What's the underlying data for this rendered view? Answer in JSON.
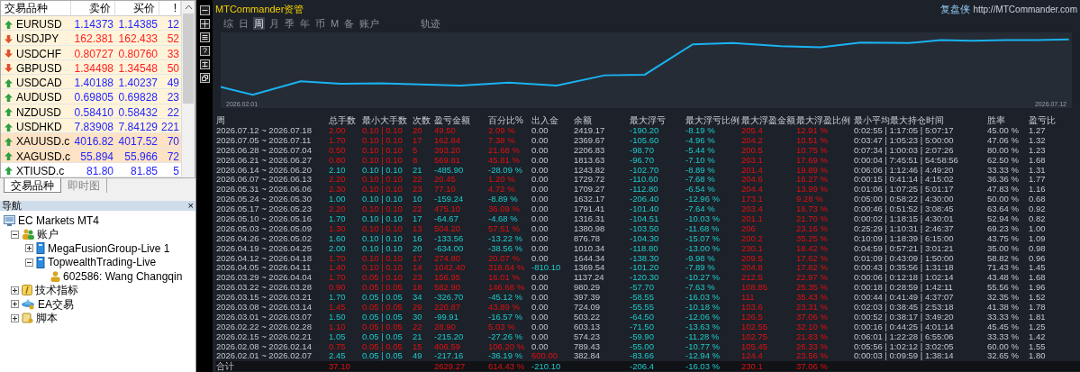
{
  "market_watch": {
    "columns": [
      "交易品种",
      "卖价",
      "买价",
      "!"
    ],
    "rows": [
      {
        "symbol": "EURUSD",
        "bid": "1.14373",
        "ask": "1.14385",
        "spread": "12",
        "rising": true,
        "color": "#fff4da"
      },
      {
        "symbol": "USDJPY",
        "bid": "162.381",
        "ask": "162.433",
        "spread": "52",
        "rising": false,
        "color": "#fff4da"
      },
      {
        "symbol": "USDCHF",
        "bid": "0.80727",
        "ask": "0.80760",
        "spread": "33",
        "rising": false,
        "color": "#fff4da"
      },
      {
        "symbol": "GBPUSD",
        "bid": "1.34498",
        "ask": "1.34548",
        "spread": "50",
        "rising": false,
        "color": "#fff4da"
      },
      {
        "symbol": "USDCAD",
        "bid": "1.40188",
        "ask": "1.40237",
        "spread": "49",
        "rising": true,
        "color": "#fff4da"
      },
      {
        "symbol": "AUDUSD",
        "bid": "0.69805",
        "ask": "0.69828",
        "spread": "23",
        "rising": true,
        "color": "#fff4da"
      },
      {
        "symbol": "NZDUSD",
        "bid": "0.58410",
        "ask": "0.58432",
        "spread": "22",
        "rising": true,
        "color": "#fff4da"
      },
      {
        "symbol": "USDHKD",
        "bid": "7.83908",
        "ask": "7.84129",
        "spread": "221",
        "rising": true,
        "color": "#fff4da"
      },
      {
        "symbol": "XAUUSD.c",
        "bid": "4016.82",
        "ask": "4017.52",
        "spread": "70",
        "rising": true,
        "color": "#fde2c4"
      },
      {
        "symbol": "XAGUSD.c",
        "bid": "55.894",
        "ask": "55.966",
        "spread": "72",
        "rising": true,
        "color": "#fde2c4"
      },
      {
        "symbol": "XTIUSD.c",
        "bid": "81.80",
        "ask": "81.85",
        "spread": "5",
        "rising": true,
        "color": "#ffffff"
      }
    ]
  },
  "left_tabs": [
    {
      "label": "交易品种",
      "selected": true
    },
    {
      "label": "即时图",
      "selected": false
    }
  ],
  "navigator": {
    "title": "导航",
    "close": "×",
    "tree": [
      {
        "label": "EC Markets MT4",
        "kind": "terminal",
        "children": [
          {
            "label": "账户",
            "kind": "accounts",
            "expanded": true,
            "children": [
              {
                "label": "MegaFusionGroup-Live 1",
                "kind": "server",
                "expanded": false
              },
              {
                "label": "TopwealthTrading-Live",
                "kind": "server",
                "expanded": true,
                "children": [
                  {
                    "label": "602586: Wang Changqin",
                    "kind": "user"
                  }
                ]
              }
            ]
          },
          {
            "label": "技术指标",
            "kind": "indicators",
            "expanded": false
          },
          {
            "label": "EA交易",
            "kind": "experts",
            "expanded": false
          },
          {
            "label": "脚本",
            "kind": "scripts",
            "expanded": false
          }
        ]
      }
    ]
  },
  "commander": {
    "title": "MTCommander资管",
    "site_name": "复盘侠",
    "site_url": "http://MTCommander.com",
    "tabs": [
      {
        "label": "综",
        "selected": false
      },
      {
        "label": "日",
        "selected": false
      },
      {
        "label": "周",
        "selected": true
      },
      {
        "label": "月",
        "selected": false
      },
      {
        "label": "季",
        "selected": false
      },
      {
        "label": "年",
        "selected": false
      },
      {
        "label": "币",
        "selected": false
      },
      {
        "label": "M",
        "selected": false
      },
      {
        "label": "备",
        "selected": false
      },
      {
        "label": "账户",
        "selected": false
      },
      {
        "label": "轨迹",
        "selected": false
      }
    ],
    "chart": {
      "start_label": "2026.02.01",
      "end_label": "2026.07.12"
    },
    "table": {
      "columns": [
        "周",
        "总手数",
        "最小大手数",
        "次数",
        "盈亏金额",
        "百分比%",
        "出入金",
        "余额",
        "最大浮亏",
        "最大浮亏比例",
        "最大浮盈金额",
        "最大浮盈比例",
        "最小平均最大持仓时间",
        "胜率",
        "盈亏比"
      ],
      "rows": [
        {
          "profit": true,
          "deposit": false,
          "withdrawal": false,
          "cells": [
            "2026.07.12 ~ 2026.07.18",
            "2.00",
            "0.10 | 0.10",
            "20",
            "49.50",
            "2.09 %",
            "0.00",
            "2419.17",
            "-190.20",
            "-8.19 %",
            "205.4",
            "12.91 %",
            "0:02:55 | 1:17:05 | 5:07:17",
            "45.00 %",
            "1.27"
          ]
        },
        {
          "profit": true,
          "deposit": false,
          "withdrawal": false,
          "cells": [
            "2026.07.05 ~ 2026.07.11",
            "1.70",
            "0.10 | 0.10",
            "17",
            "162.84",
            "7.38 %",
            "0.00",
            "2369.67",
            "-105.60",
            "-4.96 %",
            "204.2",
            "10.51 %",
            "0:03:47 | 1:05:23 | 5:00:00",
            "47.06 %",
            "1.32"
          ]
        },
        {
          "profit": true,
          "deposit": false,
          "withdrawal": false,
          "cells": [
            "2026.06.28 ~ 2026.07.04",
            "0.50",
            "0.10 | 0.10",
            "5",
            "393.20",
            "21.68 %",
            "0.00",
            "2206.83",
            "-98.70",
            "-5.44 %",
            "200.5",
            "10.75 %",
            "0:07:34 | 1:00:03 | 2:07:26",
            "80.00 %",
            "1.23"
          ]
        },
        {
          "profit": true,
          "deposit": false,
          "withdrawal": false,
          "cells": [
            "2026.06.21 ~ 2026.06.27",
            "0.80",
            "0.10 | 0.10",
            "8",
            "569.81",
            "45.81 %",
            "0.00",
            "1813.63",
            "-96.70",
            "-7.10 %",
            "203.1",
            "17.69 %",
            "0:00:04 | 7:45:51 | 54:58:56",
            "62.50 %",
            "1.68"
          ]
        },
        {
          "profit": false,
          "deposit": false,
          "withdrawal": false,
          "cells": [
            "2026.06.14 ~ 2026.06.20",
            "2.10",
            "0.10 | 0.10",
            "21",
            "-485.90",
            "-28.09 %",
            "0.00",
            "1243.82",
            "-102.70",
            "-8.89 %",
            "201.4",
            "19.89 %",
            "0:06:06 | 1:12:46 | 4:49:20",
            "33.33 %",
            "1.31"
          ]
        },
        {
          "profit": true,
          "deposit": false,
          "withdrawal": false,
          "cells": [
            "2026.06.07 ~ 2026.06.13",
            "2.20",
            "0.10 | 0.10",
            "22",
            "20.45",
            "1.20 %",
            "0.00",
            "1729.72",
            "-110.60",
            "-7.68 %",
            "204.6",
            "16.27 %",
            "0:00:15 | 0:41:14 | 4:15:02",
            "36.36 %",
            "1.77"
          ]
        },
        {
          "profit": true,
          "deposit": false,
          "withdrawal": false,
          "cells": [
            "2026.05.31 ~ 2026.06.06",
            "2.30",
            "0.10 | 0.10",
            "23",
            "77.10",
            "4.72 %",
            "0.00",
            "1709.27",
            "-112.80",
            "-6.54 %",
            "204.4",
            "13.99 %",
            "0:01:06 | 1:07:25 | 5:01:17",
            "47.83 %",
            "1.16"
          ]
        },
        {
          "profit": false,
          "deposit": false,
          "withdrawal": false,
          "cells": [
            "2026.05.24 ~ 2026.05.30",
            "1.00",
            "0.10 | 0.10",
            "10",
            "-159.24",
            "-8.89 %",
            "0.00",
            "1632.17",
            "-206.40",
            "-12.96 %",
            "173.1",
            "9.28 %",
            "0:05:00 | 0:58:22 | 4:30:00",
            "50.00 %",
            "0.68"
          ]
        },
        {
          "profit": true,
          "deposit": false,
          "withdrawal": false,
          "cells": [
            "2026.05.17 ~ 2026.05.23",
            "2.20",
            "0.10 | 0.10",
            "22",
            "475.10",
            "36.09 %",
            "0.00",
            "1791.41",
            "-101.40",
            "-7.64 %",
            "203.4",
            "16.73 %",
            "0:00:46 | 0:51:52 | 3:08:45",
            "63.64 %",
            "0.92"
          ]
        },
        {
          "profit": false,
          "deposit": false,
          "withdrawal": false,
          "cells": [
            "2026.05.10 ~ 2026.05.16",
            "1.70",
            "0.10 | 0.10",
            "17",
            "-64.67",
            "-4.68 %",
            "0.00",
            "1316.31",
            "-104.51",
            "-10.03 %",
            "201.1",
            "21.70 %",
            "0:00:02 | 1:18:15 | 4:30:01",
            "52.94 %",
            "0.82"
          ]
        },
        {
          "profit": true,
          "deposit": false,
          "withdrawal": false,
          "cells": [
            "2026.05.03 ~ 2026.05.09",
            "1.30",
            "0.10 | 0.10",
            "13",
            "504.20",
            "57.51 %",
            "0.00",
            "1380.98",
            "-103.50",
            "-11.68 %",
            "206",
            "23.16 %",
            "0:25:29 | 1:10:31 | 2:46:37",
            "69.23 %",
            "1.00"
          ]
        },
        {
          "profit": false,
          "deposit": false,
          "withdrawal": false,
          "cells": [
            "2026.04.26 ~ 2026.05.02",
            "1.60",
            "0.10 | 0.10",
            "16",
            "-133.56",
            "-13.22 %",
            "0.00",
            "876.78",
            "-104.30",
            "-15.07 %",
            "200.2",
            "35.25 %",
            "0:10:09 | 1:18:39 | 6:15:00",
            "43.75 %",
            "1.09"
          ]
        },
        {
          "profit": false,
          "deposit": false,
          "withdrawal": false,
          "cells": [
            "2026.04.19 ~ 2026.04.25",
            "2.00",
            "0.10 | 0.10",
            "20",
            "-634.00",
            "-38.56 %",
            "0.00",
            "1010.34",
            "-118.80",
            "-13.00 %",
            "230.1",
            "18.42 %",
            "0:04:59 | 0:57:21 | 3:01:21",
            "35.00 %",
            "0.98"
          ]
        },
        {
          "profit": true,
          "deposit": false,
          "withdrawal": false,
          "cells": [
            "2026.04.12 ~ 2026.04.18",
            "1.70",
            "0.10 | 0.10",
            "17",
            "274.80",
            "20.07 %",
            "0.00",
            "1644.34",
            "-138.30",
            "-9.98 %",
            "209.5",
            "17.62 %",
            "0:01:09 | 0:43:09 | 1:50:00",
            "58.82 %",
            "0.96"
          ]
        },
        {
          "profit": true,
          "deposit": false,
          "withdrawal": true,
          "cells": [
            "2026.04.05 ~ 2026.04.11",
            "1.40",
            "0.10 | 0.10",
            "14",
            "1042.40",
            "318.64 %",
            "-810.10",
            "1369.54",
            "-101.20",
            "-7.89 %",
            "204.8",
            "17.82 %",
            "0:00:43 | 0:35:56 | 1:31:18",
            "71.43 %",
            "1.45"
          ]
        },
        {
          "profit": true,
          "deposit": false,
          "withdrawal": false,
          "cells": [
            "2026.03.29 ~ 2026.04.04",
            "1.70",
            "0.05 | 0.10",
            "23",
            "156.95",
            "16.01 %",
            "0.00",
            "1137.24",
            "-120.30",
            "-10.27 %",
            "212.5",
            "22.97 %",
            "0:00:06 | 0:12:18 | 1:02:14",
            "43.48 %",
            "1.68"
          ]
        },
        {
          "profit": true,
          "deposit": false,
          "withdrawal": false,
          "cells": [
            "2026.03.22 ~ 2026.03.28",
            "0.90",
            "0.05 | 0.05",
            "18",
            "582.90",
            "146.68 %",
            "0.00",
            "980.29",
            "-57.70",
            "-7.63 %",
            "108.85",
            "25.35 %",
            "0:00:18 | 0:28:59 | 1:42:11",
            "55.56 %",
            "1.96"
          ]
        },
        {
          "profit": false,
          "deposit": false,
          "withdrawal": false,
          "cells": [
            "2026.03.15 ~ 2026.03.21",
            "1.70",
            "0.05 | 0.05",
            "34",
            "-326.70",
            "-45.12 %",
            "0.00",
            "397.39",
            "-58.55",
            "-16.03 %",
            "111",
            "35.43 %",
            "0:00:44 | 0:41:49 | 4:37:07",
            "32.35 %",
            "1.52"
          ]
        },
        {
          "profit": true,
          "deposit": false,
          "withdrawal": false,
          "cells": [
            "2026.03.08 ~ 2026.03.14",
            "1.45",
            "0.05 | 0.05",
            "29",
            "220.87",
            "43.89 %",
            "0.00",
            "724.09",
            "-55.55",
            "-10.18 %",
            "103.6",
            "23.31 %",
            "0:02:03 | 0:38:45 | 2:53:18",
            "41.38 %",
            "1.78"
          ]
        },
        {
          "profit": false,
          "deposit": false,
          "withdrawal": false,
          "cells": [
            "2026.03.01 ~ 2026.03.07",
            "1.50",
            "0.05 | 0.05",
            "30",
            "-99.91",
            "-16.57 %",
            "0.00",
            "503.22",
            "-64.50",
            "-12.06 %",
            "126.5",
            "37.06 %",
            "0:00:52 | 0:38:17 | 3:49:20",
            "33.33 %",
            "1.81"
          ]
        },
        {
          "profit": true,
          "deposit": false,
          "withdrawal": false,
          "cells": [
            "2026.02.22 ~ 2026.02.28",
            "1.10",
            "0.05 | 0.05",
            "22",
            "28.90",
            "5.03 %",
            "0.00",
            "603.13",
            "-71.50",
            "-13.63 %",
            "102.55",
            "32.10 %",
            "0:00:16 | 0:44:25 | 4:01:14",
            "45.45 %",
            "1.25"
          ]
        },
        {
          "profit": false,
          "deposit": false,
          "withdrawal": false,
          "cells": [
            "2026.02.15 ~ 2026.02.21",
            "1.05",
            "0.05 | 0.05",
            "21",
            "-215.20",
            "-27.26 %",
            "0.00",
            "574.23",
            "-59.90",
            "-11.28 %",
            "102.75",
            "21.83 %",
            "0:06:01 | 1:22:28 | 6:55:06",
            "33.33 %",
            "1.42"
          ]
        },
        {
          "profit": true,
          "deposit": false,
          "withdrawal": false,
          "cells": [
            "2026.02.08 ~ 2026.02.14",
            "0.75",
            "0.05 | 0.05",
            "15",
            "406.59",
            "106.20 %",
            "0.00",
            "789.43",
            "-55.00",
            "-10.77 %",
            "105.45",
            "26.33 %",
            "0:05:56 | 1:02:12 | 3:02:05",
            "60.00 %",
            "1.55"
          ]
        },
        {
          "profit": false,
          "deposit": true,
          "withdrawal": false,
          "cells": [
            "2026.02.01 ~ 2026.02.07",
            "2.45",
            "0.05 | 0.05",
            "49",
            "-217.16",
            "-36.19 %",
            "600.00",
            "382.84",
            "-83.66",
            "-12.94 %",
            "124.4",
            "23.56 %",
            "0:00:03 | 0:09:59 | 1:38:14",
            "32.65 %",
            "1.80"
          ]
        }
      ],
      "total": {
        "profit": true,
        "deposit": false,
        "withdrawal": true,
        "cells": [
          "合计",
          "37.10",
          null,
          null,
          "2629.27",
          "614.43 %",
          "-210.10",
          null,
          "-206.4",
          "-16.03 %",
          "230.1",
          "37.06 %",
          null,
          null,
          null
        ]
      }
    }
  }
}
